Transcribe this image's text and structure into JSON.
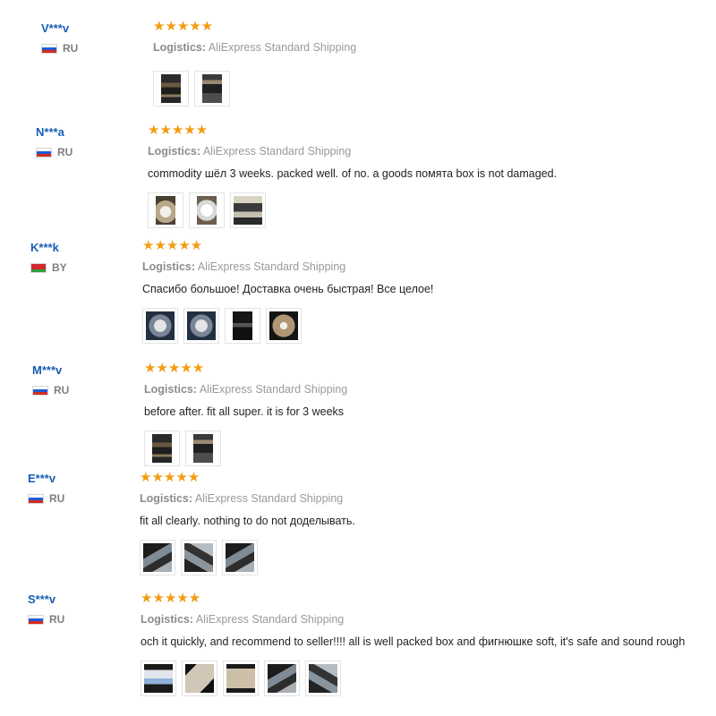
{
  "reviews": [
    {
      "name": "V***v",
      "country": "RU",
      "flag": "ru",
      "stars": "★★★★★",
      "logistics_label": "Logistics:",
      "logistics_value": "AliExpress Standard Shipping",
      "text": "",
      "photos": [
        "dash",
        "dash2"
      ]
    },
    {
      "name": "N***a",
      "country": "RU",
      "flag": "ru",
      "stars": "★★★★★",
      "logistics_label": "Logistics:",
      "logistics_value": "AliExpress Standard Shipping",
      "text": "commodity шёл 3 weeks. packed well. of no. a goods помята box is not damaged.",
      "photos": [
        "box",
        "white",
        "panel"
      ]
    },
    {
      "name": "K***k",
      "country": "BY",
      "flag": "by",
      "stars": "★★★★★",
      "logistics_label": "Logistics:",
      "logistics_value": "AliExpress Standard Shipping",
      "text": "Спасибо большое! Доставка очень быстрая! Все целое!",
      "photos": [
        "blue",
        "blue",
        "black",
        "brown"
      ]
    },
    {
      "name": "M***v",
      "country": "RU",
      "flag": "ru",
      "stars": "★★★★★",
      "logistics_label": "Logistics:",
      "logistics_value": "AliExpress Standard Shipping",
      "text": "before after. fit all super. it is for 3 weeks",
      "photos": [
        "dash",
        "dash2"
      ]
    },
    {
      "name": "E***v",
      "country": "RU",
      "flag": "ru",
      "stars": "★★★★★",
      "logistics_label": "Logistics:",
      "logistics_value": "AliExpress Standard Shipping",
      "text": "fit all clearly. nothing to do not доделывать.",
      "photos": [
        "car",
        "car2",
        "car"
      ]
    },
    {
      "name": "S***v",
      "country": "RU",
      "flag": "ru",
      "stars": "★★★★★",
      "logistics_label": "Logistics:",
      "logistics_value": "AliExpress Standard Shipping",
      "text": "och it quickly, and recommend to seller!!!! all is well packed box and фигнюшке soft, it's safe and sound rough",
      "photos": [
        "blu2",
        "pkg",
        "lid",
        "car",
        "car2"
      ]
    }
  ]
}
